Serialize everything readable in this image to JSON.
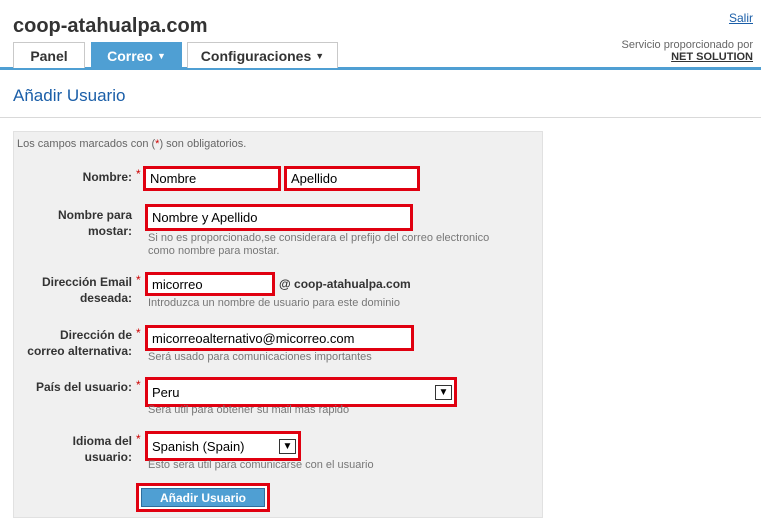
{
  "header": {
    "site_title": "coop-atahualpa.com",
    "logout_label": "Salir",
    "provider_label": "Servicio proporcionado por",
    "provider_name": "NET SOLUTION"
  },
  "tabs": [
    {
      "label": "Panel",
      "active": false
    },
    {
      "label": "Correo",
      "active": true
    },
    {
      "label": "Configuraciones",
      "active": false
    }
  ],
  "page_title": "Añadir Usuario",
  "form": {
    "required_note_before": "Los campos marcados con (",
    "required_note_star": "*",
    "required_note_after": ") son obligatorios.",
    "fields": {
      "nombre": {
        "label": "Nombre:",
        "first": "Nombre",
        "last": "Apellido"
      },
      "display": {
        "label_line1": "Nombre para",
        "label_line2": "mostar:",
        "value": "Nombre y Apellido",
        "hint_line1": "Si no es proporcionado,se considerara el prefijo del correo electronico",
        "hint_line2": "como nombre para mostar."
      },
      "email": {
        "label_line1": "Dirección Email",
        "label_line2": "deseada:",
        "value": "micorreo",
        "suffix": "@ coop-atahualpa.com",
        "hint": "Introduzca un nombre de usuario para este dominio"
      },
      "alt_email": {
        "label_line1": "Dirección de",
        "label_line2": "correo alternativa:",
        "value": "micorreoalternativo@micorreo.com",
        "hint": "Será usado para comunicaciones importantes"
      },
      "country": {
        "label": "País del usuario:",
        "value": "Peru",
        "hint": "Sera util para obtener su mail mas rapido"
      },
      "language": {
        "label_line1": "Idioma del",
        "label_line2": "usuario:",
        "value": "Spanish (Spain)",
        "hint": "Esto sera util para comunicarse con el usuario"
      }
    },
    "star": "*",
    "submit_label": "Añadir Usuario"
  },
  "colors": {
    "accent": "#4f9fd3",
    "highlight": "#e00010",
    "link": "#1a5ea8"
  }
}
